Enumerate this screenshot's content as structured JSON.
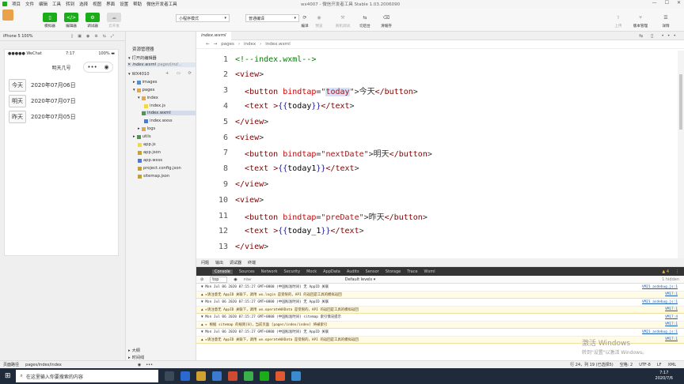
{
  "menu": [
    "项目",
    "文件",
    "编辑",
    "工具",
    "转到",
    "选择",
    "视图",
    "界面",
    "设置",
    "帮助",
    "微信开发者工具"
  ],
  "window_title": "wx4007 - 微信开发者工具 Stable 1.03.2006090",
  "toolbar": {
    "simulator": "模拟器",
    "editor": "编辑器",
    "debugger": "调试器",
    "cloud": "云开发",
    "mode": "小程序模式",
    "compile_mode": "普通编译",
    "compile": "编译",
    "preview": "预览",
    "real_debug": "真机调试",
    "switch_bg": "切后台",
    "clear_cache": "清缓存",
    "upload": "上传",
    "version": "版本管理",
    "details": "详情"
  },
  "simulator": {
    "device": "iPhone 5 100%",
    "carrier": "WeChat",
    "time": "7:17",
    "battery": "100%",
    "page_title": "明天几号",
    "rows": [
      {
        "button": "今天",
        "date": "2020年07月06日"
      },
      {
        "button": "明天",
        "date": "2020年07月07日"
      },
      {
        "button": "昨天",
        "date": "2020年07月05日"
      }
    ]
  },
  "filetree": {
    "title": "资源管理器",
    "open_editors": "打开的编辑器",
    "open_file": "index.wxml",
    "open_file_path": "pages\\ind...",
    "project": "WX4010",
    "items": [
      "images",
      "pages",
      "index",
      "index.js",
      "index.wxml",
      "index.wxss",
      "logs",
      "utils",
      "app.js",
      "app.json",
      "app.wxss",
      "project.config.json",
      "sitemap.json"
    ],
    "outline": "大纲",
    "timeline": "时间线"
  },
  "editor": {
    "tab": "index.wxml",
    "breadcrumb": [
      "pages",
      "index",
      "index.wxml"
    ],
    "line_numbers": [
      "1",
      "2",
      "3",
      "4",
      "5",
      "6",
      "7",
      "8",
      "9",
      "10",
      "11",
      "12",
      "13"
    ],
    "lines": [
      "<!--index.wxml-->",
      "<view>",
      "  <button bindtap=\"today\">今天</button>",
      "  <text >{{today}}</text>",
      "</view>",
      "<view>",
      "  <button bindtap=\"nextDate\">明天</button>",
      "  <text >{{today1}}</text>",
      "</view>",
      "<view>",
      "  <button bindtap=\"preDate\">昨天</button>",
      "  <text >{{today_1}}</text>",
      "</view>"
    ]
  },
  "console": {
    "panel_tabs": [
      "问题",
      "输出",
      "调试器",
      "终端"
    ],
    "tabs": [
      "Console",
      "Sources",
      "Network",
      "Security",
      "Mock",
      "AppData",
      "Audits",
      "Sensor",
      "Storage",
      "Trace",
      "Wxml"
    ],
    "warn_count": "4",
    "context": "top",
    "filter_placeholder": "Filter",
    "levels": "Default levels ▾",
    "hidden": "1 hidden",
    "logs": [
      {
        "kind": "i",
        "text": "▼ Mon Jul 06 2020 07:15:27 GMT+0800 (中国标准时间) 无 AppID 关联",
        "src": "VM21 asdebug.js:1"
      },
      {
        "kind": "w",
        "text": "▲ ▸请注意无 AppID 关联下，调用 wx.login 是受限的，API 的返回是工具的模拟返回",
        "src": "VM17:1"
      },
      {
        "kind": "i",
        "text": "▼ Mon Jul 06 2020 07:15:27 GMT+0800 (中国标准时间) 无 AppID 关联",
        "src": "VM21 asdebug.js:1"
      },
      {
        "kind": "w",
        "text": "▲ ▸请注意无 AppID 关联下，调用 wx.operateWXData 是受限的，API 的返回是工具的模拟返回",
        "src": "VM17:1"
      },
      {
        "kind": "i",
        "text": "▼ Mon Jul 06 2020 07:15:27 GMT+0800 (中国标准时间) sitemap 索引情况提示",
        "src": "VM17:4"
      },
      {
        "kind": "w",
        "text": "▲ ▸ 根据 sitemap 的规则[0]，当前页面 [pages/index/index] 将被索引",
        "src": "VM17:1"
      },
      {
        "kind": "i",
        "text": "▼ Mon Jul 06 2020 07:15:27 GMT+0800 (中国标准时间) 无 AppID 关联",
        "src": "VM21 asdebug.js:1"
      },
      {
        "kind": "w",
        "text": "▲ ▸请注意无 AppID 关联下，调用 wx.operateWXData 是受限的，API 的返回是工具的模拟返回",
        "src": "VM17:1"
      }
    ]
  },
  "watermark": {
    "line1": "激活 Windows",
    "line2": "转到\"设置\"以激活 Windows。"
  },
  "statusbar": {
    "path_label": "页面路径",
    "path": "pages/index/index",
    "cursor": "行 24，列 19 (已选择5)",
    "spaces": "空格: 2",
    "encoding": "UTF-8",
    "eol": "LF",
    "lang": "XML"
  },
  "taskbar": {
    "search_placeholder": "在这里输入你要搜索的内容",
    "time": "7:17",
    "date": "2020/7/6"
  },
  "colors": {
    "toolbar_green": "#1aad19",
    "accent": "#1a5fb4",
    "tag": "#800000",
    "attr": "#c00000",
    "string": "#a31515",
    "comment": "#008000"
  }
}
